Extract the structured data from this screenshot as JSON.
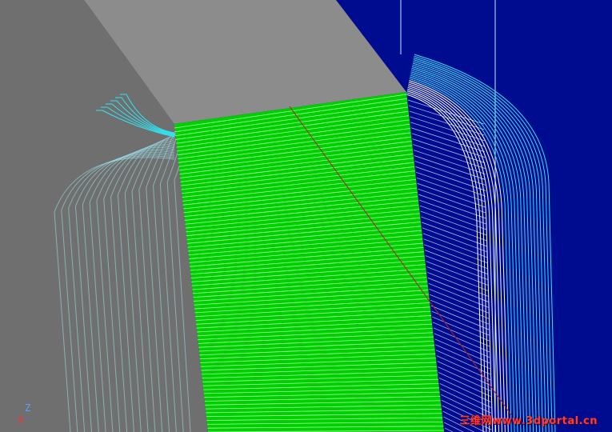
{
  "viewport": {
    "colors": {
      "background": "#000c8f",
      "toolpath": "#2fe6f2",
      "toolpath_on_light": "#ffffff",
      "part_top": "#8c8c8c",
      "part_side": "#6f6f6f",
      "machined_face": "#00d000",
      "guide_line": "#c9e9ff",
      "diagonal": "#b02020"
    }
  },
  "axis": {
    "z_label": "Z",
    "x_label": "X",
    "z_color": "#5aa0ff",
    "x_color": "#ff3030"
  },
  "watermark": {
    "text": "三维网www.3dportal.cn",
    "color": "#ff3a3a"
  }
}
